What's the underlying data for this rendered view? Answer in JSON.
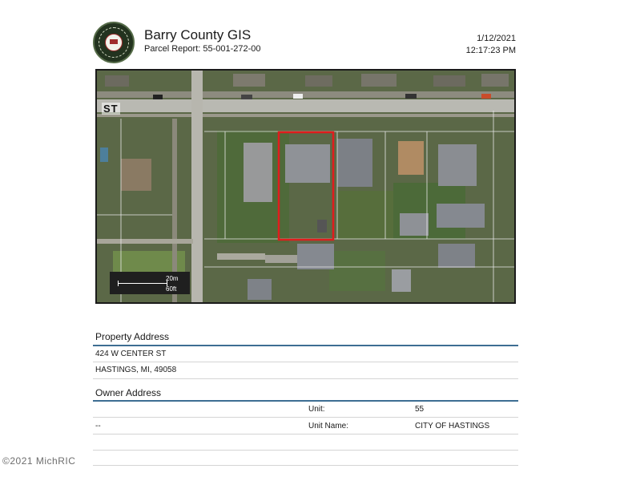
{
  "header": {
    "title": "Barry County GIS",
    "subtitle": "Parcel Report: 55-001-272-00",
    "date": "1/12/2021",
    "time": "12:17:23 PM"
  },
  "map": {
    "street_label": "ST",
    "scale_metric": "20m",
    "scale_imperial": "60ft"
  },
  "property_address": {
    "heading": "Property Address",
    "line1": "424 W CENTER ST",
    "line2": "HASTINGS, MI, 49058"
  },
  "owner_address": {
    "heading": "Owner Address",
    "row1_col1": "",
    "unit_label": "Unit:",
    "unit_value": "55",
    "row2_col1": "--",
    "unit_name_label": "Unit Name:",
    "unit_name_value": "CITY OF HASTINGS"
  },
  "footer": {
    "copyright": "©2021 MichRIC"
  },
  "colors": {
    "accent_rule": "#3e6e93",
    "parcel_outline": "#e01d1d"
  }
}
